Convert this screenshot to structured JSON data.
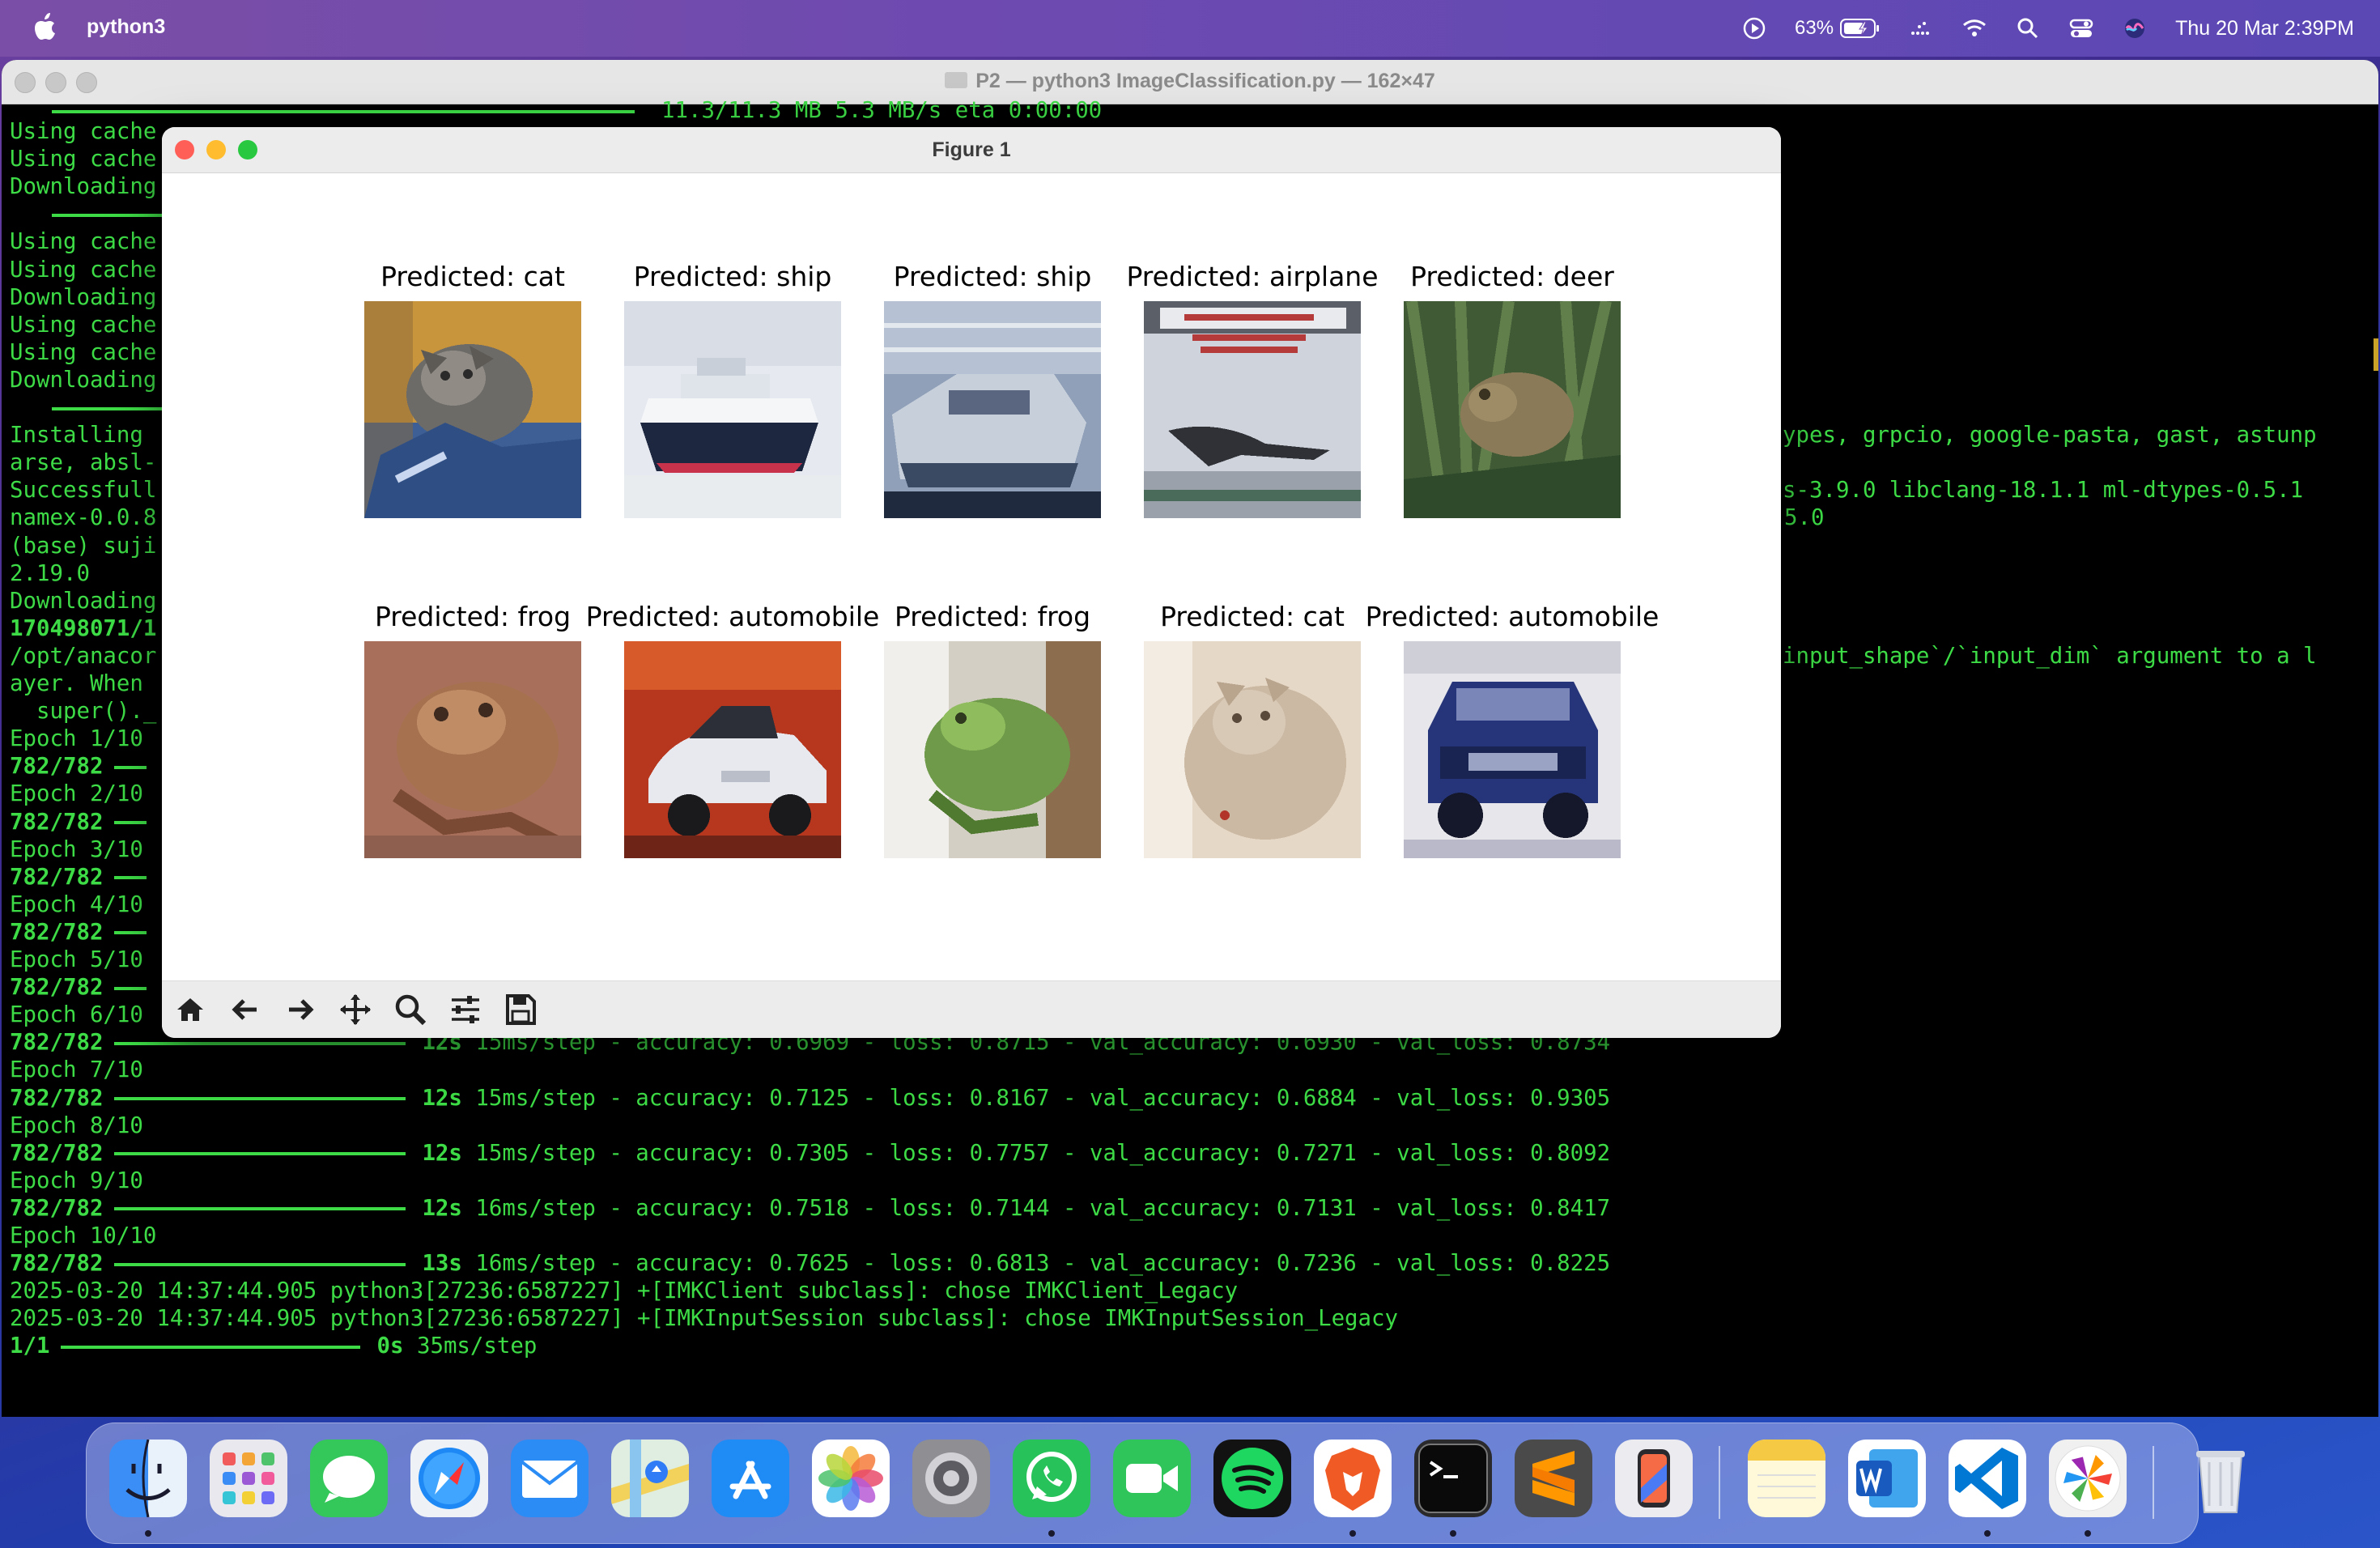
{
  "menubar": {
    "app_name": "python3",
    "battery_percent": "63%",
    "clock": "Thu 20 Mar  2:39PM",
    "icons": [
      "apple-logo-icon",
      "play-circle-icon",
      "battery-icon",
      "dotted-icon",
      "wifi-icon",
      "search-icon",
      "control-center-icon",
      "siri-icon"
    ]
  },
  "terminal": {
    "title": "P2 — python3 ImageClassification.py — 162×47",
    "progress_top": "11.3/11.3 MB 5.3 MB/s eta 0:00:00",
    "left_lines": [
      "Using cache",
      "Using cache",
      "Downloading",
      "",
      "Using cache",
      "Using cache",
      "Downloading",
      "Using cache",
      "Using cache",
      "Downloading",
      "",
      "Installing ",
      "arse, absl-",
      "Successfull",
      "namex-0.0.8",
      "(base) suji",
      "2.19.0",
      "Downloading",
      "170498071/1",
      "/opt/anacor",
      "ayer. When ",
      "  super()._",
      "Epoch 1/10",
      "782/782",
      "Epoch 2/10",
      "782/782",
      "Epoch 3/10",
      "782/782",
      "Epoch 4/10",
      "782/782",
      "Epoch 5/10",
      "782/782",
      "Epoch 6/10"
    ],
    "right_lines": [
      {
        "row": 11,
        "text": "ypes, grpcio, google-pasta, gast, astunp"
      },
      {
        "row": 13,
        "text": "s-3.9.0 libclang-18.1.1 ml-dtypes-0.5.1"
      },
      {
        "row": 14,
        "text": "5.0"
      },
      {
        "row": 19,
        "text": "input_shape`/`input_dim` argument to a l"
      }
    ],
    "epochs": [
      {
        "step": "782/782",
        "time": "12s",
        "rest": " 15ms/step - accuracy: 0.6969 - loss: 0.8715 - val_accuracy: 0.6930 - val_loss: 0.8734"
      },
      {
        "label": "Epoch 7/10"
      },
      {
        "step": "782/782",
        "time": "12s",
        "rest": " 15ms/step - accuracy: 0.7125 - loss: 0.8167 - val_accuracy: 0.6884 - val_loss: 0.9305"
      },
      {
        "label": "Epoch 8/10"
      },
      {
        "step": "782/782",
        "time": "12s",
        "rest": " 15ms/step - accuracy: 0.7305 - loss: 0.7757 - val_accuracy: 0.7271 - val_loss: 0.8092"
      },
      {
        "label": "Epoch 9/10"
      },
      {
        "step": "782/782",
        "time": "12s",
        "rest": " 16ms/step - accuracy: 0.7518 - loss: 0.7144 - val_accuracy: 0.7131 - val_loss: 0.8417"
      },
      {
        "label": "Epoch 10/10"
      },
      {
        "step": "782/782",
        "time": "13s",
        "rest": " 16ms/step - accuracy: 0.7625 - loss: 0.6813 - val_accuracy: 0.7236 - val_loss: 0.8225"
      }
    ],
    "log_1": "2025-03-20 14:37:44.905 python3[27236:6587227] +[IMKClient subclass]: chose IMKClient_Legacy",
    "log_2": "2025-03-20 14:37:44.905 python3[27236:6587227] +[IMKInputSession subclass]: chose IMKInputSession_Legacy",
    "final_step": "1/1",
    "final_time": "0s",
    "final_rest": " 35ms/step"
  },
  "figure": {
    "title": "Figure 1",
    "predictions": [
      {
        "caption": "Predicted: cat",
        "image": "cat"
      },
      {
        "caption": "Predicted: ship",
        "image": "ship-white"
      },
      {
        "caption": "Predicted: ship",
        "image": "ship-grey"
      },
      {
        "caption": "Predicted: airplane",
        "image": "airplane"
      },
      {
        "caption": "Predicted: deer",
        "image": "frog-in-grass"
      },
      {
        "caption": "Predicted: frog",
        "image": "frog-brown"
      },
      {
        "caption": "Predicted: automobile",
        "image": "car-white"
      },
      {
        "caption": "Predicted: frog",
        "image": "frog-green"
      },
      {
        "caption": "Predicted: cat",
        "image": "cat-light"
      },
      {
        "caption": "Predicted: automobile",
        "image": "car-blue"
      }
    ],
    "toolbar": [
      "home-icon",
      "back-arrow-icon",
      "forward-arrow-icon",
      "pan-icon",
      "zoom-icon",
      "configure-subplots-icon",
      "save-icon"
    ]
  },
  "dock": {
    "apps": [
      "Finder",
      "Launchpad",
      "Messages",
      "Safari",
      "Mail",
      "Maps",
      "App Store",
      "Photos",
      "System Settings",
      "WhatsApp",
      "FaceTime",
      "Spotify",
      "Brave",
      "Terminal",
      "Sublime Text",
      "iPhone Mirroring",
      "Notes",
      "Word",
      "VS Code",
      "Pinwheel",
      "Trash"
    ]
  }
}
